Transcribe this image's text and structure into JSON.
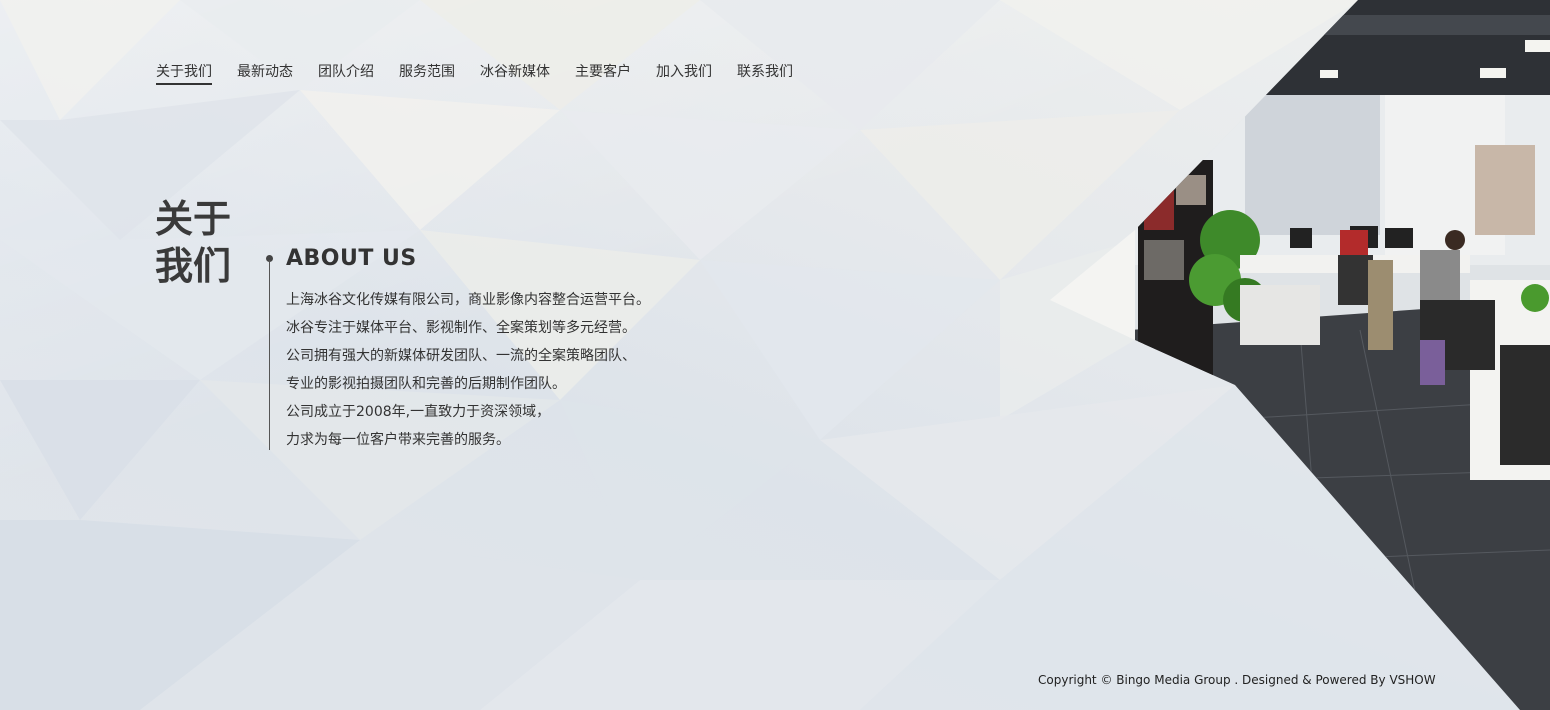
{
  "nav": {
    "items": [
      {
        "label": "关于我们",
        "active": true
      },
      {
        "label": "最新动态",
        "active": false
      },
      {
        "label": "团队介绍",
        "active": false
      },
      {
        "label": "服务范围",
        "active": false
      },
      {
        "label": "冰谷新媒体",
        "active": false
      },
      {
        "label": "主要客户",
        "active": false
      },
      {
        "label": "加入我们",
        "active": false
      },
      {
        "label": "联系我们",
        "active": false
      }
    ]
  },
  "about": {
    "title_line1": "关于",
    "title_line2": "我们",
    "subtitle": "ABOUT US",
    "lines": [
      "上海冰谷文化传媒有限公司，商业影像内容整合运营平台。",
      "冰谷专注于媒体平台、影视制作、全案策划等多元经营。",
      "公司拥有强大的新媒体研发团队、一流的全案策略团队、",
      "专业的影视拍摄团队和完善的后期制作团队。",
      "公司成立于2008年,一直致力于资深领域，",
      "力求为每一位客户带来完善的服务。"
    ]
  },
  "footer": {
    "copyright": "Copyright © Bingo Media Group . Designed & Powered By VSHOW"
  },
  "colors": {
    "text": "#333333",
    "background": "#e4e8ec",
    "floor": "#3c3f44"
  }
}
